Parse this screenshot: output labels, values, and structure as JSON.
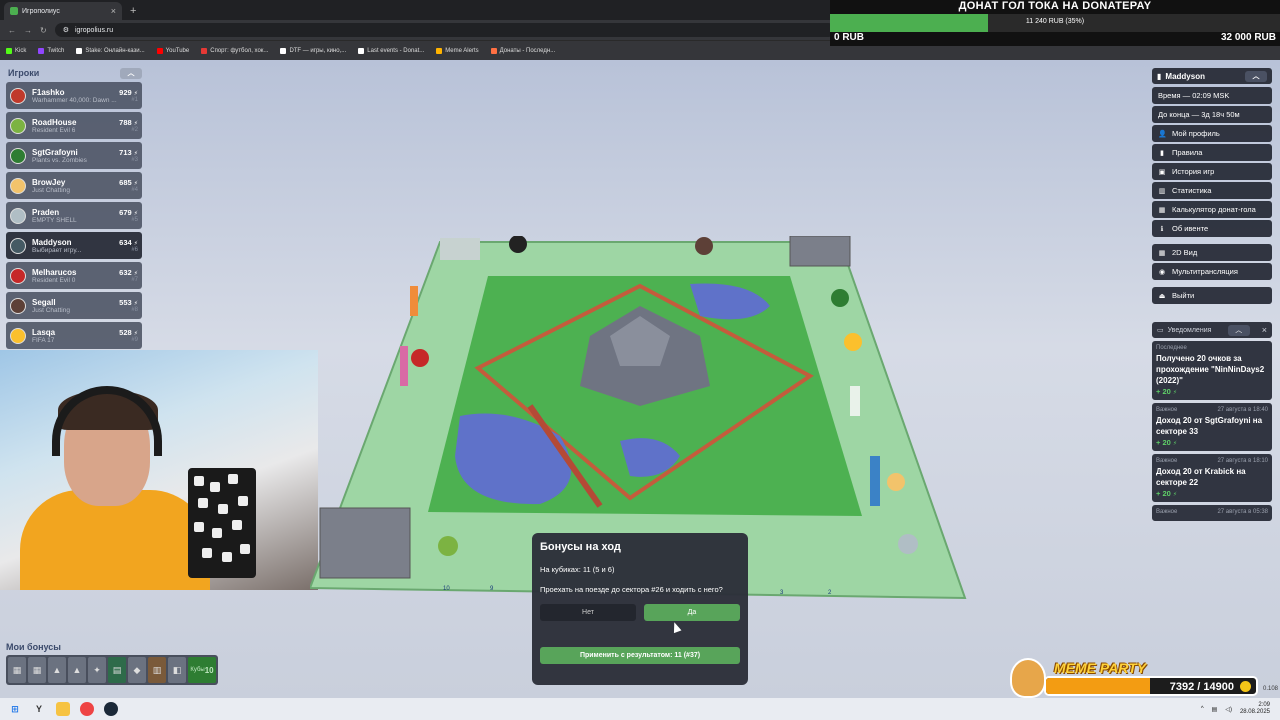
{
  "browser": {
    "tab_title": "Игрополиус",
    "url": "igropolius.ru",
    "bookmarks": [
      {
        "label": "Kick",
        "color": "#53fc18"
      },
      {
        "label": "Twitch",
        "color": "#9146ff"
      },
      {
        "label": "Stake: Онлайн-кази...",
        "color": "#ffffff"
      },
      {
        "label": "YouTube",
        "color": "#ff0000"
      },
      {
        "label": "Спорт: футбол, хок...",
        "color": "#e53935"
      },
      {
        "label": "DTF — игры, кино,...",
        "color": "#ffffff"
      },
      {
        "label": "Last events - Donat...",
        "color": "#ffffff"
      },
      {
        "label": "Meme Alerts",
        "color": "#ffb300"
      },
      {
        "label": "Донаты - Последн...",
        "color": "#ff7043"
      }
    ]
  },
  "donation": {
    "title": "ДОНАТ ГОЛ ТОКА НА DONATEPAY",
    "progress_text": "11 240 RUB (35%)",
    "progress_fraction": 0.35,
    "min": "0 RUB",
    "max": "32 000 RUB",
    "fill_color": "#4caf50"
  },
  "players": {
    "header": "Игроки",
    "list": [
      {
        "name": "F1ashko",
        "game": "Warhammer 40,000: Dawn ...",
        "score": "929",
        "rank": "#1",
        "avatar": "#c0392b"
      },
      {
        "name": "RoadHouse",
        "game": "Resident Evil 6",
        "score": "788",
        "rank": "#2",
        "avatar": "#7cb342"
      },
      {
        "name": "SgtGrafoyni",
        "game": "Plants vs. Zombies",
        "score": "713",
        "rank": "#3",
        "avatar": "#2e7d32"
      },
      {
        "name": "BrowJey",
        "game": "Just Chatting",
        "score": "685",
        "rank": "#4",
        "avatar": "#f2c36b"
      },
      {
        "name": "Praden",
        "game": "EMPTY SHELL",
        "score": "679",
        "rank": "#5",
        "avatar": "#b0bec5"
      },
      {
        "name": "Maddyson",
        "game": "Выбирает игру...",
        "score": "634",
        "rank": "#6",
        "avatar": "#455a64"
      },
      {
        "name": "Melharucos",
        "game": "Resident Evil 0",
        "score": "632",
        "rank": "#7",
        "avatar": "#c62828"
      },
      {
        "name": "Segall",
        "game": "Just Chatting",
        "score": "553",
        "rank": "#8",
        "avatar": "#5d4037"
      },
      {
        "name": "Lasqa",
        "game": "FIFA 17",
        "score": "528",
        "rank": "#9",
        "avatar": "#fbc02d"
      }
    ],
    "score_icon": "⚡"
  },
  "my_bonuses": {
    "label": "Мои бонусы",
    "extra_label": "Кубы",
    "extra_value": "10"
  },
  "right_panel": {
    "username": "Maddyson",
    "time": "Время — 02:09 MSK",
    "remaining": "До конца — 3д 18ч 50м",
    "menu": [
      {
        "label": "Мой профиль",
        "icon": "user-icon",
        "glyph": "👤"
      },
      {
        "label": "Правила",
        "icon": "book-icon",
        "glyph": "▮"
      },
      {
        "label": "История игр",
        "icon": "history-icon",
        "glyph": "▣"
      },
      {
        "label": "Статистика",
        "icon": "chart-icon",
        "glyph": "▥"
      },
      {
        "label": "Калькулятор донат-гола",
        "icon": "calculator-icon",
        "glyph": "▦"
      },
      {
        "label": "Об ивенте",
        "icon": "info-icon",
        "glyph": "ℹ"
      }
    ],
    "menu2": [
      {
        "label": "2D Вид",
        "icon": "grid-icon",
        "glyph": "▦"
      },
      {
        "label": "Мультитрансляция",
        "icon": "broadcast-icon",
        "glyph": "◉"
      }
    ],
    "logout": "Выйти"
  },
  "notifications": {
    "header": "Уведомления",
    "items": [
      {
        "tag": "Последнее",
        "date": "",
        "text": "Получено 20 очков за прохождение \"NinNinDays2 (2022)\"",
        "bonus": "+ 20"
      },
      {
        "tag": "Важное",
        "date": "27 августа в 18:40",
        "text": "Доход 20 от SgtGrafoyni на секторе 33",
        "bonus": "+ 20"
      },
      {
        "tag": "Важное",
        "date": "27 августа в 18:10",
        "text": "Доход 20 от Krabick на секторе 22",
        "bonus": "+ 20"
      },
      {
        "tag": "Важное",
        "date": "27 августа в 05:38",
        "text": "",
        "bonus": ""
      }
    ]
  },
  "dialog": {
    "title": "Бонусы на ход",
    "dice": "На кубиках: 11 (5 и 6)",
    "question": "Проехать на поезде до сектора #26 и ходить с него?",
    "no": "Нет",
    "yes": "Да",
    "apply": "Применить с результатом: 11 (#37)"
  },
  "board": {
    "sector_labels": [
      "10",
      "9",
      "3",
      "2"
    ]
  },
  "meme_party": {
    "title": "MEME PARTY",
    "value": "7392 / 14900",
    "fraction": 0.496,
    "fill_color": "#f39c12"
  },
  "taskbar": {
    "time": "2:09",
    "date": "28.08.2025",
    "version": "0.108"
  }
}
